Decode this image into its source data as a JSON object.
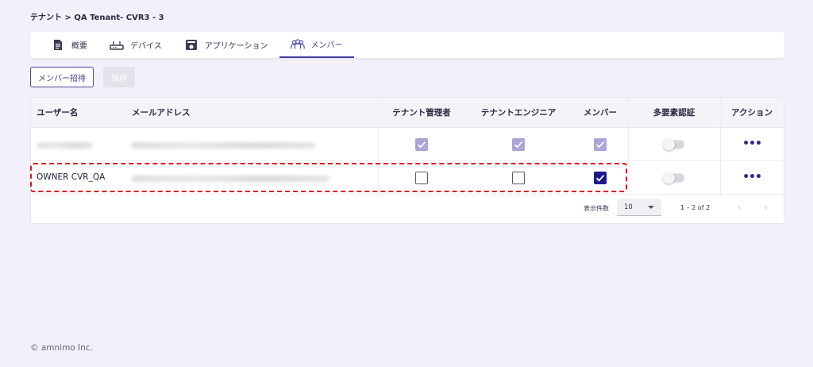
{
  "breadcrumb": "テナント > QA Tenant- CVR3 - 3",
  "tabs": [
    {
      "label": "概要",
      "icon": "document-icon"
    },
    {
      "label": "デバイス",
      "icon": "router-icon"
    },
    {
      "label": "アプリケーション",
      "icon": "app-window-icon"
    },
    {
      "label": "メンバー",
      "icon": "people-icon",
      "active": true
    }
  ],
  "actions": {
    "invite_label": "メンバー招待",
    "save_label": "保存"
  },
  "table": {
    "columns": {
      "username": "ユーザー名",
      "email": "メールアドレス",
      "tenant_admin": "テナント管理者",
      "tenant_engineer": "テナントエンジニア",
      "member": "メンバー",
      "mfa": "多要素認証",
      "action": "アクション"
    },
    "rows": [
      {
        "username": "",
        "username_redacted": true,
        "email_redacted": true,
        "tenant_admin": "checked-disabled",
        "tenant_engineer": "checked-disabled",
        "member": "checked-disabled",
        "mfa": false,
        "action_icon": "more-dots-icon"
      },
      {
        "username": "OWNER CVR_QA",
        "username_redacted": false,
        "email_redacted": true,
        "tenant_admin": "unchecked",
        "tenant_engineer": "unchecked",
        "member": "checked",
        "mfa": false,
        "action_icon": "more-dots-icon",
        "highlighted": true
      }
    ],
    "pagination": {
      "rows_label": "表示件数",
      "rows_per_page": "10",
      "range": "1 – 2 of 2"
    }
  },
  "footer": "© amnimo Inc.",
  "colors": {
    "accent": "#1a1a8c",
    "highlight": "#e0141c",
    "checkbox_disabled": "#a9a6d8"
  }
}
